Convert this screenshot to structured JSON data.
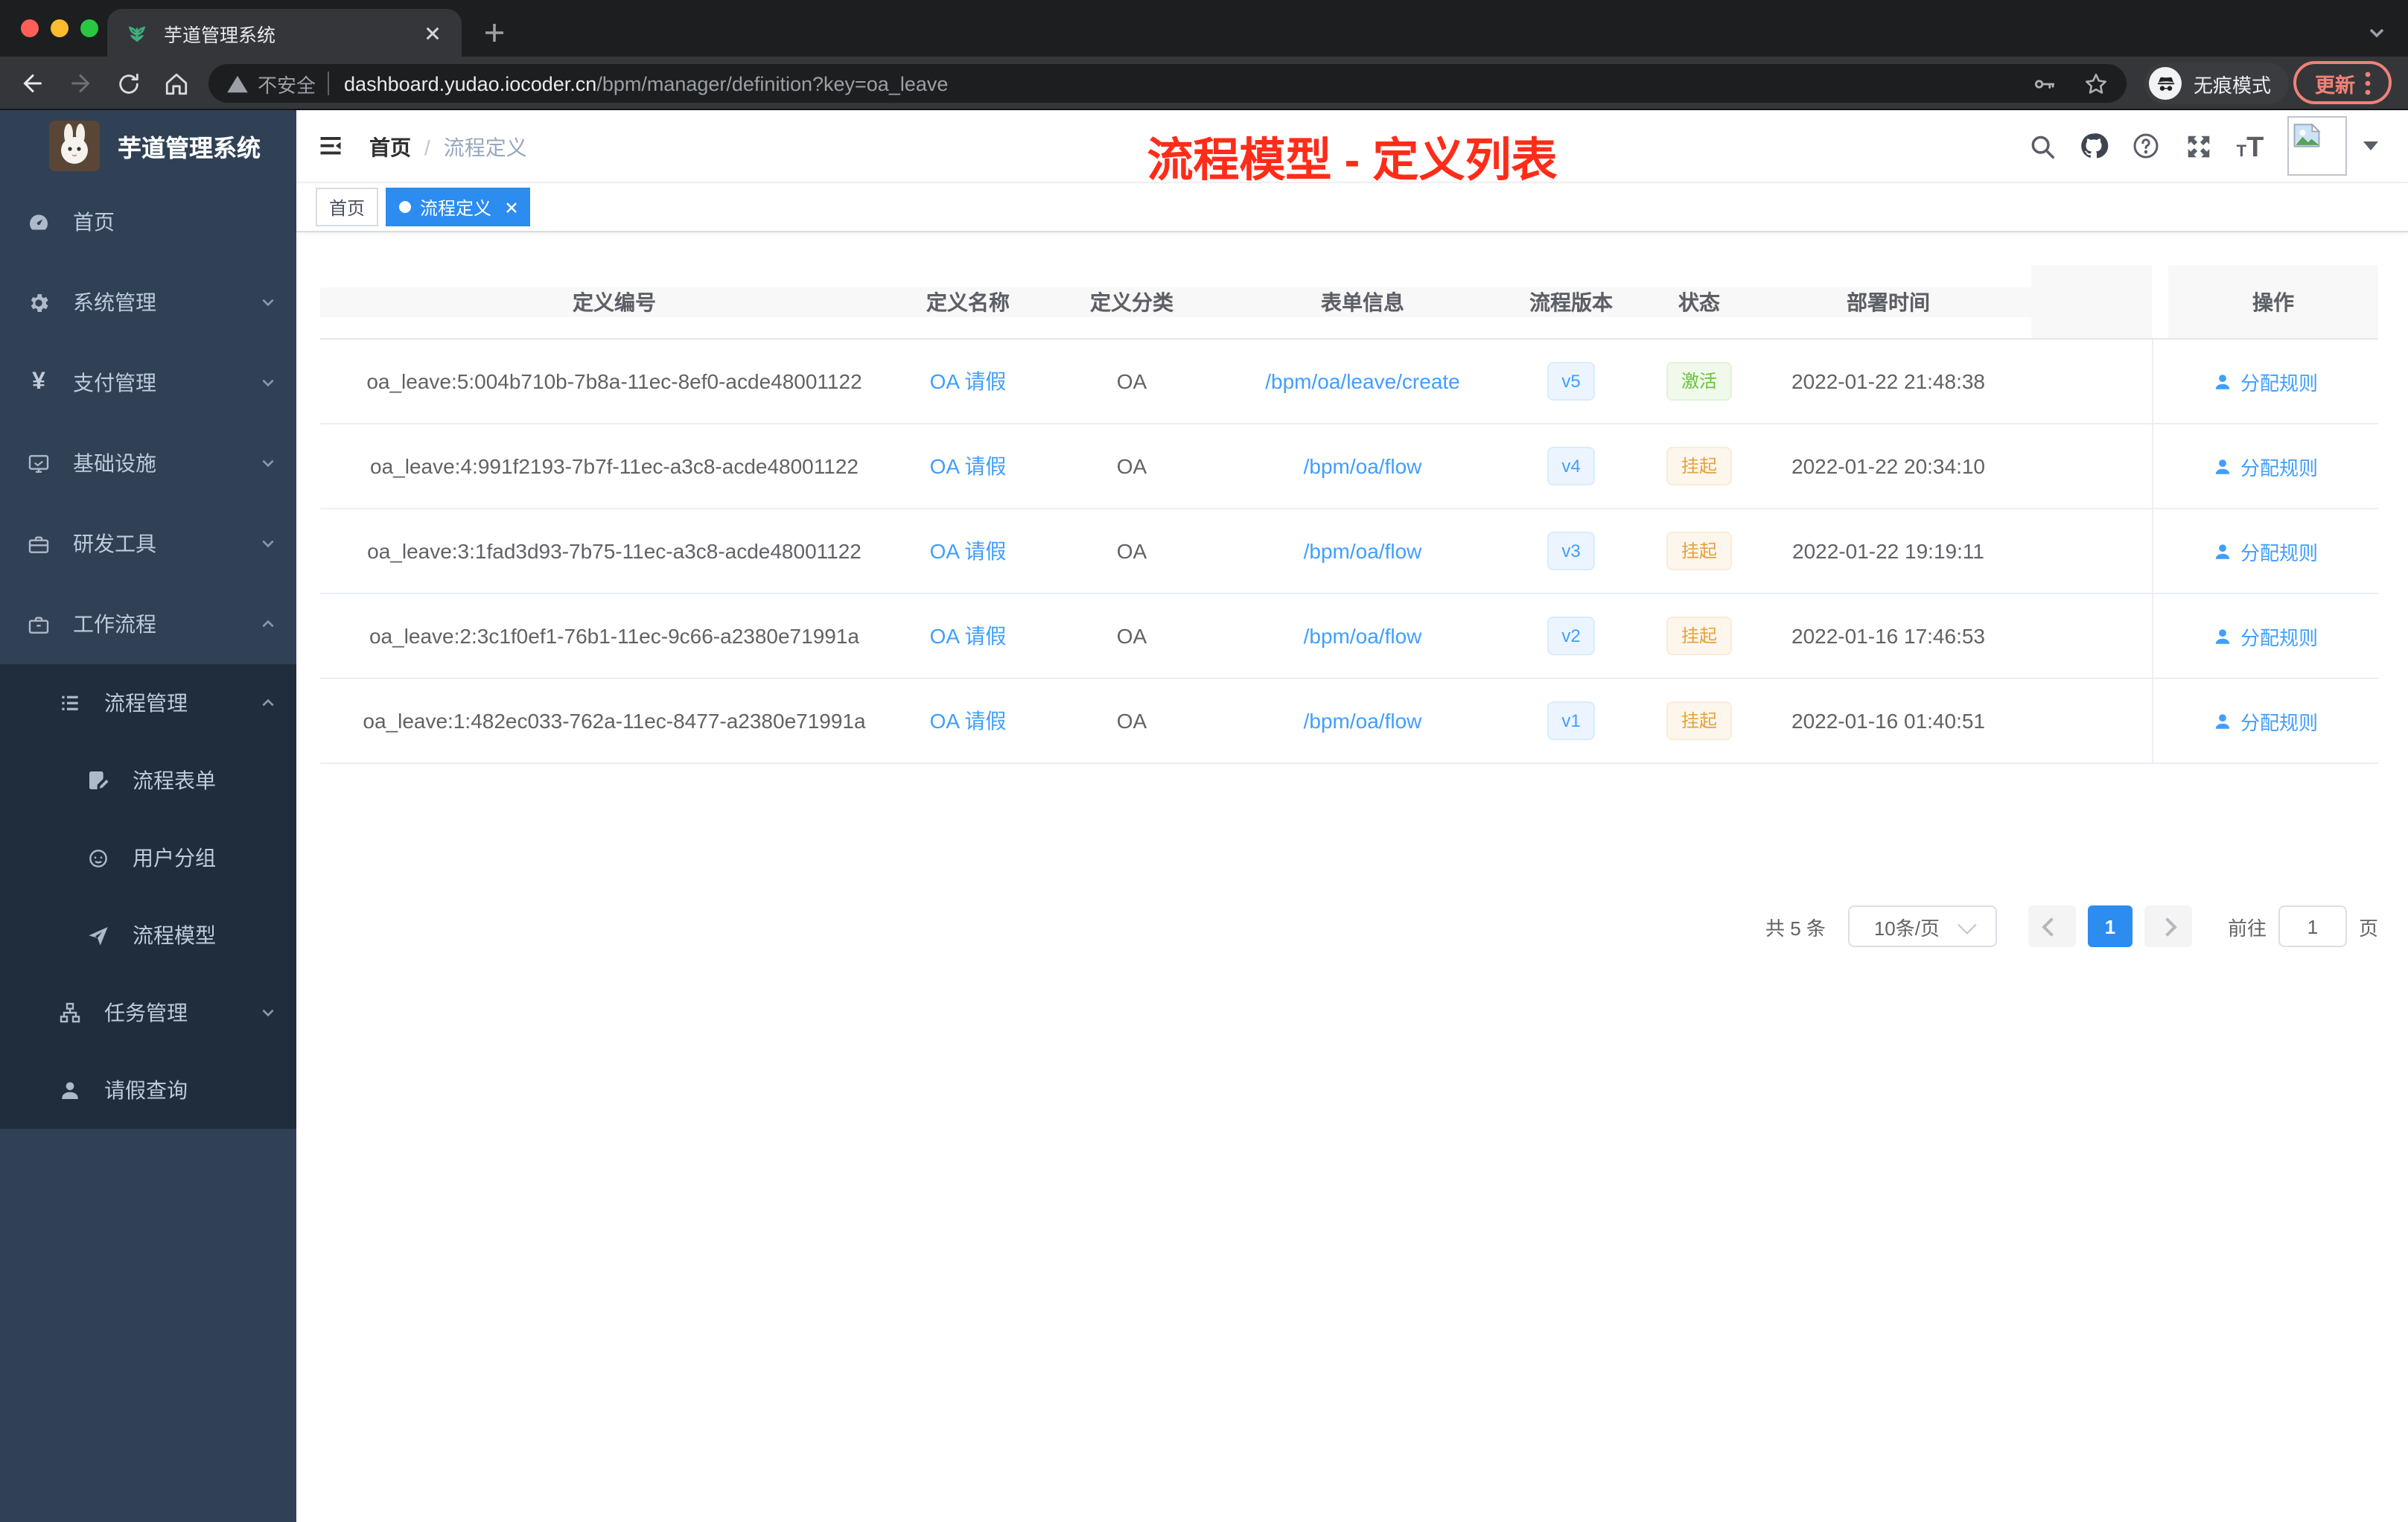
{
  "browser": {
    "tab_title": "芋道管理系统",
    "security_label": "不安全",
    "url_host": "dashboard.yudao.iocoder.cn",
    "url_path": "/bpm/manager/definition?key=oa_leave",
    "incognito_label": "无痕模式",
    "update_label": "更新"
  },
  "sidebar": {
    "logo_title": "芋道管理系统",
    "items": [
      {
        "label": "首页",
        "icon": "dashboard-icon"
      },
      {
        "label": "系统管理",
        "icon": "gear-icon",
        "state": "collapsed"
      },
      {
        "label": "支付管理",
        "icon": "yen-icon",
        "state": "collapsed"
      },
      {
        "label": "基础设施",
        "icon": "monitor-icon",
        "state": "collapsed"
      },
      {
        "label": "研发工具",
        "icon": "toolbox-icon",
        "state": "collapsed"
      },
      {
        "label": "工作流程",
        "icon": "briefcase-icon",
        "state": "expanded",
        "children": [
          {
            "label": "流程管理",
            "icon": "list-icon",
            "state": "expanded",
            "children": [
              {
                "label": "流程表单",
                "icon": "form-icon"
              },
              {
                "label": "用户分组",
                "icon": "people-icon"
              },
              {
                "label": "流程模型",
                "icon": "send-icon"
              }
            ]
          },
          {
            "label": "任务管理",
            "icon": "tree-icon",
            "state": "collapsed"
          },
          {
            "label": "请假查询",
            "icon": "user-icon"
          }
        ]
      }
    ]
  },
  "topbar": {
    "breadcrumb": {
      "home": "首页",
      "separator": "/",
      "current": "流程定义"
    },
    "annotation": "流程模型 - 定义列表",
    "icons": [
      "search-icon",
      "github-icon",
      "question-icon",
      "fullscreen-icon",
      "font-size-icon",
      "avatar",
      "dropdown-caret"
    ]
  },
  "tags": {
    "items": [
      {
        "label": "首页",
        "active": false
      },
      {
        "label": "流程定义",
        "active": true
      }
    ]
  },
  "glyphs": {
    "yen": "¥",
    "question": "?",
    "font_small": "T",
    "font_large": "T"
  },
  "table": {
    "columns": [
      "定义编号",
      "定义名称",
      "定义分类",
      "表单信息",
      "流程版本",
      "状态",
      "部署时间",
      "操作"
    ],
    "rows": [
      {
        "id": "oa_leave:5:004b710b-7b8a-11ec-8ef0-acde48001122",
        "name": "OA 请假",
        "category": "OA",
        "form": "/bpm/oa/leave/create",
        "version": "v5",
        "status": "激活",
        "status_type": "success",
        "time": "2022-01-22 21:48:38",
        "action": "分配规则"
      },
      {
        "id": "oa_leave:4:991f2193-7b7f-11ec-a3c8-acde48001122",
        "name": "OA 请假",
        "category": "OA",
        "form": "/bpm/oa/flow",
        "version": "v4",
        "status": "挂起",
        "status_type": "warning",
        "time": "2022-01-22 20:34:10",
        "action": "分配规则"
      },
      {
        "id": "oa_leave:3:1fad3d93-7b75-11ec-a3c8-acde48001122",
        "name": "OA 请假",
        "category": "OA",
        "form": "/bpm/oa/flow",
        "version": "v3",
        "status": "挂起",
        "status_type": "warning",
        "time": "2022-01-22 19:19:11",
        "action": "分配规则"
      },
      {
        "id": "oa_leave:2:3c1f0ef1-76b1-11ec-9c66-a2380e71991a",
        "name": "OA 请假",
        "category": "OA",
        "form": "/bpm/oa/flow",
        "version": "v2",
        "status": "挂起",
        "status_type": "warning",
        "time": "2022-01-16 17:46:53",
        "action": "分配规则"
      },
      {
        "id": "oa_leave:1:482ec033-762a-11ec-8477-a2380e71991a",
        "name": "OA 请假",
        "category": "OA",
        "form": "/bpm/oa/flow",
        "version": "v1",
        "status": "挂起",
        "status_type": "warning",
        "time": "2022-01-16 01:40:51",
        "action": "分配规则"
      }
    ]
  },
  "pagination": {
    "total": "共 5 条",
    "page_size": "10条/页",
    "current": "1",
    "goto": "前往",
    "goto_value": "1",
    "unit": "页"
  },
  "colors": {
    "primary": "#409eff",
    "success": "#67c23a",
    "warning": "#e6a23c",
    "annotation_red": "#fe2c19",
    "active_blue": "#2d8cf0",
    "sidebar_bg": "#304156",
    "submenu_bg": "#1f2d3d"
  }
}
